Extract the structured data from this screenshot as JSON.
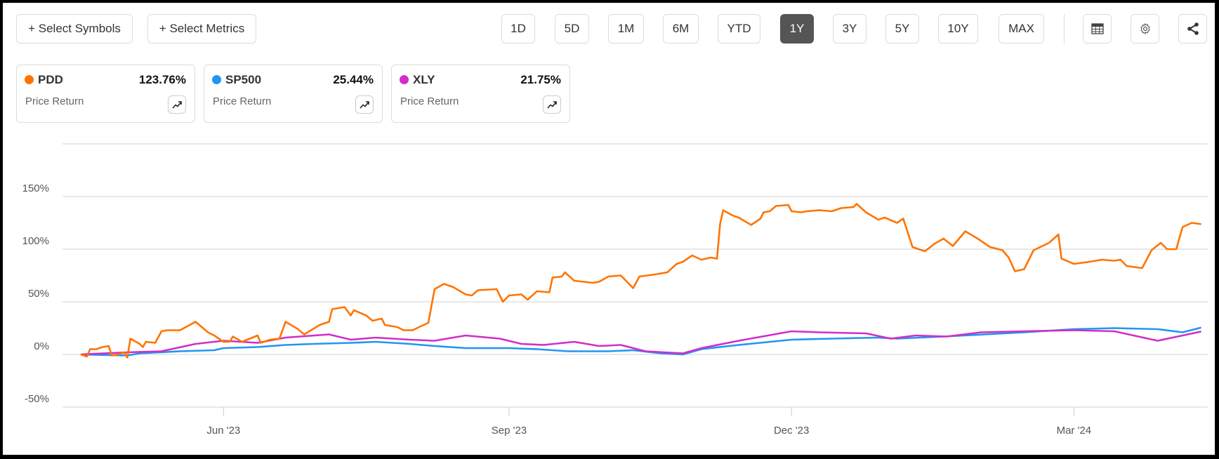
{
  "toolbar": {
    "select_symbols": "+ Select Symbols",
    "select_metrics": "+ Select Metrics",
    "ranges": [
      "1D",
      "5D",
      "1M",
      "6M",
      "YTD",
      "1Y",
      "3Y",
      "5Y",
      "10Y",
      "MAX"
    ],
    "active_range": "1Y",
    "icons": [
      "table-icon",
      "gear-icon",
      "share-icon"
    ]
  },
  "legend_cards": [
    {
      "symbol": "PDD",
      "value": "123.76%",
      "metric": "Price Return",
      "color": "#ff7400"
    },
    {
      "symbol": "SP500",
      "value": "25.44%",
      "metric": "Price Return",
      "color": "#2196f3"
    },
    {
      "symbol": "XLY",
      "value": "21.75%",
      "metric": "Price Return",
      "color": "#d12fc7"
    }
  ],
  "chart_data": {
    "type": "line",
    "title": "",
    "xlabel": "",
    "ylabel": "",
    "xlim": [
      "2023-04-16",
      "2024-04-12"
    ],
    "ylim": [
      -50,
      200
    ],
    "y_ticks": [
      -50,
      0,
      50,
      100,
      150,
      200
    ],
    "y_tick_labels": [
      "-50%",
      "0%",
      "50%",
      "100%",
      "150%",
      ""
    ],
    "x_ticks": [
      {
        "date": "2023-06-01",
        "label": "Jun '23"
      },
      {
        "date": "2023-09-01",
        "label": "Sep '23"
      },
      {
        "date": "2023-12-01",
        "label": "Dec '23"
      },
      {
        "date": "2024-03-01",
        "label": "Mar '24"
      }
    ],
    "grid": true,
    "series": [
      {
        "name": "SP500",
        "color": "#2196f3",
        "points": [
          [
            "2023-04-16",
            0
          ],
          [
            "2023-05-01",
            -1
          ],
          [
            "2023-05-05",
            1
          ],
          [
            "2023-05-18",
            3
          ],
          [
            "2023-05-29",
            4
          ],
          [
            "2023-06-01",
            6
          ],
          [
            "2023-06-12",
            7
          ],
          [
            "2023-06-21",
            9
          ],
          [
            "2023-06-30",
            10
          ],
          [
            "2023-07-12",
            11
          ],
          [
            "2023-07-20",
            12
          ],
          [
            "2023-07-31",
            10
          ],
          [
            "2023-08-08",
            8
          ],
          [
            "2023-08-18",
            6
          ],
          [
            "2023-09-01",
            6
          ],
          [
            "2023-09-10",
            5
          ],
          [
            "2023-09-20",
            3
          ],
          [
            "2023-10-03",
            3
          ],
          [
            "2023-10-11",
            4
          ],
          [
            "2023-10-20",
            1
          ],
          [
            "2023-10-27",
            0
          ],
          [
            "2023-11-02",
            5
          ],
          [
            "2023-11-14",
            9
          ],
          [
            "2023-12-01",
            14
          ],
          [
            "2023-12-14",
            15
          ],
          [
            "2023-12-29",
            16
          ],
          [
            "2024-01-04",
            15
          ],
          [
            "2024-01-19",
            17
          ],
          [
            "2024-02-01",
            19
          ],
          [
            "2024-02-14",
            21
          ],
          [
            "2024-03-01",
            24
          ],
          [
            "2024-03-14",
            25
          ],
          [
            "2024-03-28",
            24
          ],
          [
            "2024-04-05",
            21
          ],
          [
            "2024-04-11",
            25.44
          ]
        ]
      },
      {
        "name": "XLY",
        "color": "#d12fc7",
        "points": [
          [
            "2023-04-16",
            0
          ],
          [
            "2023-05-01",
            2
          ],
          [
            "2023-05-12",
            3
          ],
          [
            "2023-05-23",
            10
          ],
          [
            "2023-06-01",
            13
          ],
          [
            "2023-06-12",
            11
          ],
          [
            "2023-06-21",
            16
          ],
          [
            "2023-07-05",
            19
          ],
          [
            "2023-07-12",
            14
          ],
          [
            "2023-07-20",
            16
          ],
          [
            "2023-07-31",
            14
          ],
          [
            "2023-08-08",
            13
          ],
          [
            "2023-08-18",
            18
          ],
          [
            "2023-08-29",
            15
          ],
          [
            "2023-09-05",
            10
          ],
          [
            "2023-09-12",
            9
          ],
          [
            "2023-09-22",
            12
          ],
          [
            "2023-09-30",
            8
          ],
          [
            "2023-10-07",
            9
          ],
          [
            "2023-10-15",
            3
          ],
          [
            "2023-10-27",
            1
          ],
          [
            "2023-11-02",
            6
          ],
          [
            "2023-11-14",
            13
          ],
          [
            "2023-12-01",
            22
          ],
          [
            "2023-12-10",
            21
          ],
          [
            "2023-12-25",
            20
          ],
          [
            "2024-01-02",
            15
          ],
          [
            "2024-01-10",
            18
          ],
          [
            "2024-01-20",
            17
          ],
          [
            "2024-01-31",
            21
          ],
          [
            "2024-02-14",
            22
          ],
          [
            "2024-03-01",
            23
          ],
          [
            "2024-03-14",
            22
          ],
          [
            "2024-03-28",
            13
          ],
          [
            "2024-04-05",
            18
          ],
          [
            "2024-04-11",
            21.75
          ]
        ]
      },
      {
        "name": "PDD",
        "color": "#ff7400",
        "points": [
          [
            "2023-04-16",
            0
          ],
          [
            "2023-04-18",
            -2
          ],
          [
            "2023-04-19",
            5
          ],
          [
            "2023-04-21",
            5
          ],
          [
            "2023-04-23",
            7
          ],
          [
            "2023-04-25",
            8
          ],
          [
            "2023-04-26",
            -1
          ],
          [
            "2023-04-28",
            0
          ],
          [
            "2023-04-30",
            2
          ],
          [
            "2023-05-01",
            -3
          ],
          [
            "2023-05-02",
            15
          ],
          [
            "2023-05-05",
            10
          ],
          [
            "2023-05-06",
            7
          ],
          [
            "2023-05-07",
            12
          ],
          [
            "2023-05-10",
            11
          ],
          [
            "2023-05-12",
            22
          ],
          [
            "2023-05-14",
            23
          ],
          [
            "2023-05-18",
            23
          ],
          [
            "2023-05-23",
            31
          ],
          [
            "2023-05-27",
            21
          ],
          [
            "2023-05-29",
            18
          ],
          [
            "2023-06-01",
            12
          ],
          [
            "2023-06-03",
            12
          ],
          [
            "2023-06-04",
            17
          ],
          [
            "2023-06-07",
            12
          ],
          [
            "2023-06-12",
            18
          ],
          [
            "2023-06-13",
            11
          ],
          [
            "2023-06-16",
            14
          ],
          [
            "2023-06-19",
            15
          ],
          [
            "2023-06-21",
            31
          ],
          [
            "2023-06-25",
            24
          ],
          [
            "2023-06-27",
            19
          ],
          [
            "2023-07-02",
            28
          ],
          [
            "2023-07-05",
            31
          ],
          [
            "2023-07-06",
            43
          ],
          [
            "2023-07-10",
            45
          ],
          [
            "2023-07-12",
            37
          ],
          [
            "2023-07-13",
            42
          ],
          [
            "2023-07-17",
            37
          ],
          [
            "2023-07-19",
            32
          ],
          [
            "2023-07-22",
            34
          ],
          [
            "2023-07-23",
            28
          ],
          [
            "2023-07-27",
            26
          ],
          [
            "2023-07-29",
            23
          ],
          [
            "2023-08-01",
            23
          ],
          [
            "2023-08-03",
            26
          ],
          [
            "2023-08-06",
            30
          ],
          [
            "2023-08-08",
            62
          ],
          [
            "2023-08-11",
            67
          ],
          [
            "2023-08-14",
            64
          ],
          [
            "2023-08-18",
            57
          ],
          [
            "2023-08-20",
            56
          ],
          [
            "2023-08-22",
            61
          ],
          [
            "2023-08-28",
            62
          ],
          [
            "2023-08-30",
            50
          ],
          [
            "2023-09-01",
            56
          ],
          [
            "2023-09-05",
            57
          ],
          [
            "2023-09-07",
            52
          ],
          [
            "2023-09-10",
            60
          ],
          [
            "2023-09-14",
            59
          ],
          [
            "2023-09-15",
            73
          ],
          [
            "2023-09-18",
            74
          ],
          [
            "2023-09-19",
            78
          ],
          [
            "2023-09-22",
            70
          ],
          [
            "2023-09-28",
            68
          ],
          [
            "2023-09-30",
            69
          ],
          [
            "2023-10-03",
            74
          ],
          [
            "2023-10-07",
            75
          ],
          [
            "2023-10-09",
            69
          ],
          [
            "2023-10-11",
            63
          ],
          [
            "2023-10-13",
            74
          ],
          [
            "2023-10-18",
            76
          ],
          [
            "2023-10-22",
            78
          ],
          [
            "2023-10-25",
            86
          ],
          [
            "2023-10-27",
            88
          ],
          [
            "2023-10-30",
            94
          ],
          [
            "2023-11-02",
            90
          ],
          [
            "2023-11-05",
            92
          ],
          [
            "2023-11-07",
            91
          ],
          [
            "2023-11-08",
            124
          ],
          [
            "2023-11-09",
            137
          ],
          [
            "2023-11-12",
            132
          ],
          [
            "2023-11-14",
            130
          ],
          [
            "2023-11-18",
            123
          ],
          [
            "2023-11-21",
            129
          ],
          [
            "2023-11-22",
            135
          ],
          [
            "2023-11-24",
            136
          ],
          [
            "2023-11-26",
            141
          ],
          [
            "2023-11-30",
            142
          ],
          [
            "2023-12-01",
            136
          ],
          [
            "2023-12-04",
            135
          ],
          [
            "2023-12-06",
            136
          ],
          [
            "2023-12-10",
            137
          ],
          [
            "2023-12-14",
            136
          ],
          [
            "2023-12-17",
            139
          ],
          [
            "2023-12-21",
            140
          ],
          [
            "2023-12-22",
            143
          ],
          [
            "2023-12-25",
            135
          ],
          [
            "2023-12-29",
            128
          ],
          [
            "2023-12-31",
            130
          ],
          [
            "2024-01-04",
            125
          ],
          [
            "2024-01-06",
            129
          ],
          [
            "2024-01-09",
            102
          ],
          [
            "2024-01-13",
            98
          ],
          [
            "2024-01-16",
            105
          ],
          [
            "2024-01-19",
            110
          ],
          [
            "2024-01-22",
            103
          ],
          [
            "2024-01-26",
            117
          ],
          [
            "2024-01-30",
            110
          ],
          [
            "2024-02-03",
            102
          ],
          [
            "2024-02-07",
            99
          ],
          [
            "2024-02-09",
            92
          ],
          [
            "2024-02-11",
            79
          ],
          [
            "2024-02-14",
            81
          ],
          [
            "2024-02-17",
            99
          ],
          [
            "2024-02-22",
            106
          ],
          [
            "2024-02-25",
            114
          ],
          [
            "2024-02-26",
            91
          ],
          [
            "2024-03-01",
            86
          ],
          [
            "2024-03-06",
            88
          ],
          [
            "2024-03-10",
            90
          ],
          [
            "2024-03-14",
            89
          ],
          [
            "2024-03-16",
            90
          ],
          [
            "2024-03-18",
            84
          ],
          [
            "2024-03-23",
            82
          ],
          [
            "2024-03-26",
            99
          ],
          [
            "2024-03-29",
            106
          ],
          [
            "2024-03-31",
            100
          ],
          [
            "2024-04-03",
            100
          ],
          [
            "2024-04-05",
            121
          ],
          [
            "2024-04-08",
            125
          ],
          [
            "2024-04-11",
            123.76
          ]
        ]
      }
    ]
  }
}
